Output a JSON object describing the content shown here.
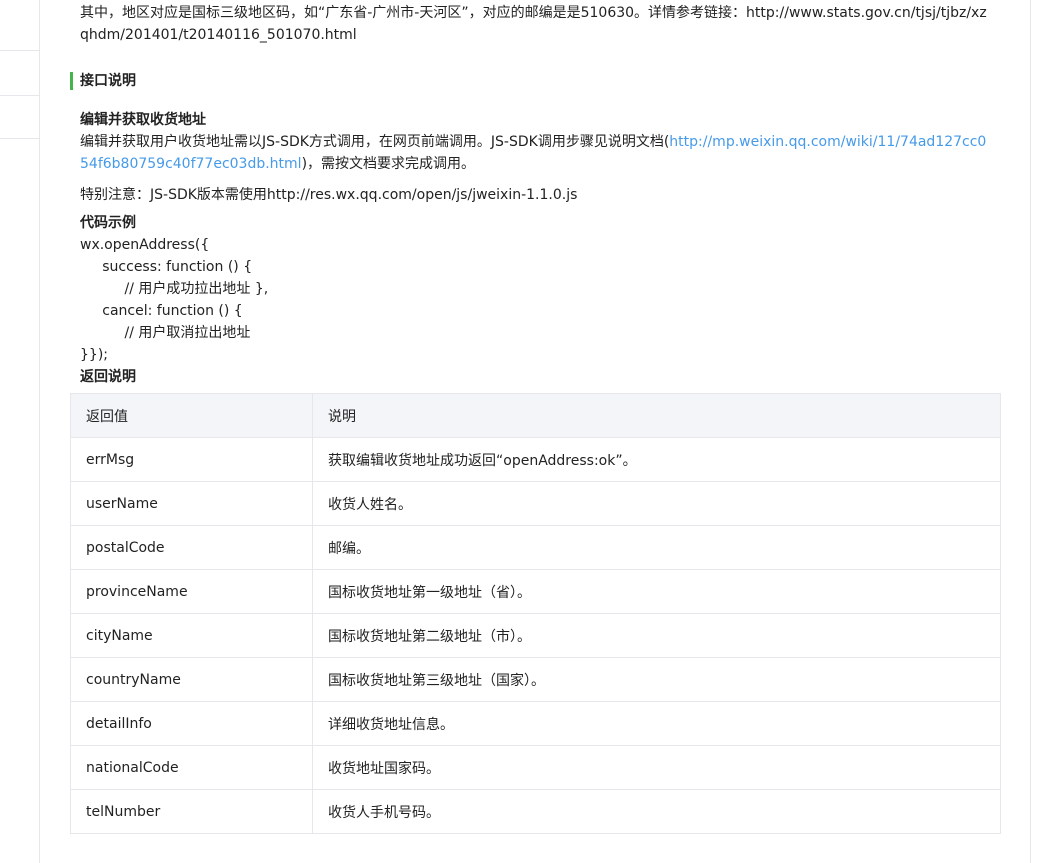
{
  "intro": {
    "text": "其中，地区对应是国标三级地区码，如“广东省-广州市-天河区”，对应的邮编是是510630。详情参考链接：http://www.stats.gov.cn/tjsj/tjbz/xzqhdm/201401/t20140116_501070.html"
  },
  "section": {
    "heading": "接口说明"
  },
  "api": {
    "title": "编辑并获取收货地址",
    "desc_prefix": "编辑并获取用户收货地址需以JS-SDK方式调用，在网页前端调用。JS-SDK调用步骤见说明文档(",
    "doc_link": "http://mp.weixin.qq.com/wiki/11/74ad127cc054f6b80759c40f77ec03db.html",
    "desc_suffix": ")，需按文档要求完成调用。",
    "notice": "特别注意：JS-SDK版本需使用http://res.wx.qq.com/open/js/jweixin-1.1.0.js"
  },
  "code": {
    "title": "代码示例",
    "lines": [
      "wx.openAddress({",
      "     success: function () {",
      "          // 用户成功拉出地址 },",
      "     cancel: function () {",
      "          // 用户取消拉出地址",
      "}});"
    ]
  },
  "returns": {
    "title": "返回说明",
    "headers": [
      "返回值",
      "说明"
    ],
    "rows": [
      [
        "errMsg",
        "获取编辑收货地址成功返回“openAddress:ok”。"
      ],
      [
        "userName",
        "收货人姓名。"
      ],
      [
        "postalCode",
        "邮编。"
      ],
      [
        "provinceName",
        "国标收货地址第一级地址（省）。"
      ],
      [
        "cityName",
        "国标收货地址第二级地址（市）。"
      ],
      [
        "countryName",
        "国标收货地址第三级地址（国家）。"
      ],
      [
        "detailInfo",
        "详细收货地址信息。"
      ],
      [
        "nationalCode",
        "收货地址国家码。"
      ],
      [
        "telNumber",
        "收货人手机号码。"
      ]
    ]
  },
  "colors": {
    "accent": "#44b549",
    "link": "#459ae9",
    "border": "#e7e7eb",
    "header_bg": "#f4f5f9"
  }
}
